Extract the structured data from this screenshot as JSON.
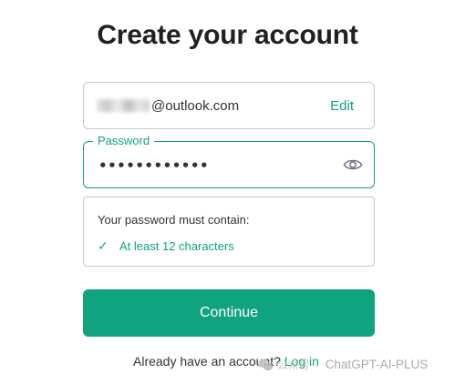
{
  "header": {
    "title": "Create your account"
  },
  "email": {
    "value_suffix": "@outlook.com",
    "edit_label": "Edit"
  },
  "password": {
    "label": "Password",
    "masked_value": "••••••••••••"
  },
  "requirements": {
    "heading": "Your password must contain:",
    "items": [
      {
        "check": "✓",
        "text": "At least 12 characters"
      }
    ]
  },
  "actions": {
    "continue_label": "Continue"
  },
  "footer": {
    "prompt": "Already have an account?",
    "login_label": "Log in"
  },
  "watermark": {
    "cn": "公众号",
    "dot": "·",
    "brand": "ChatGPT-AI-PLUS"
  },
  "colors": {
    "accent": "#10a37f",
    "border": "#c2c8d0",
    "text": "#2d333a"
  }
}
